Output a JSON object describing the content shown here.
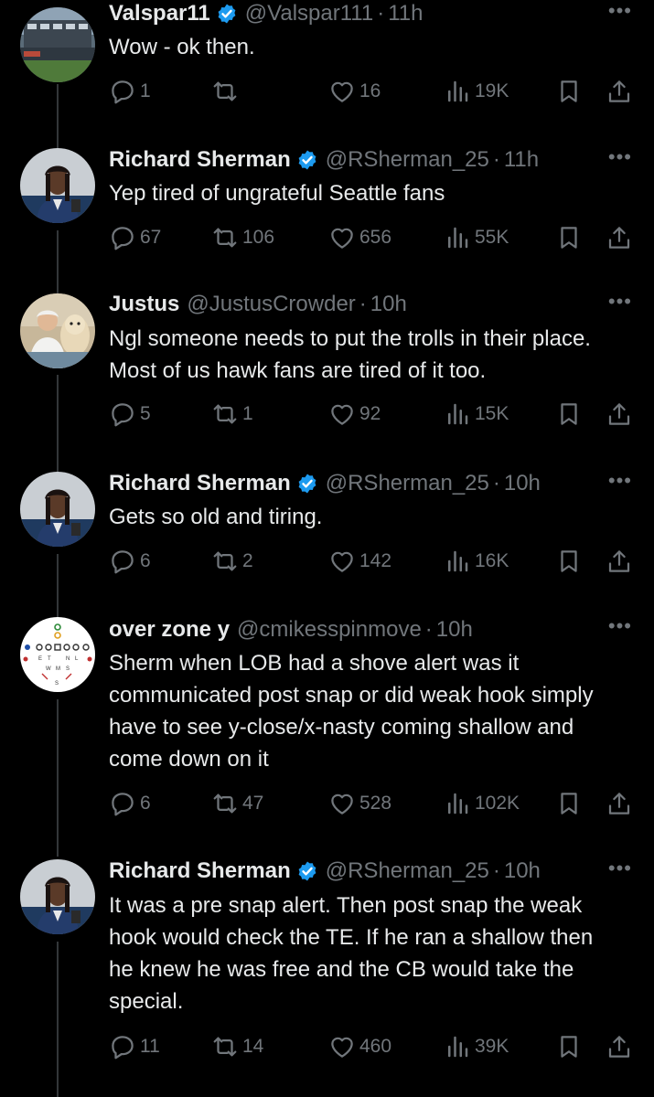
{
  "tweets": [
    {
      "name": "Valspar11",
      "verified": true,
      "handle": "@Valspar111",
      "time": "11h",
      "text": "Wow - ok then.",
      "replies": "1",
      "retweets": "",
      "likes": "16",
      "views": "19K"
    },
    {
      "name": "Richard Sherman",
      "verified": true,
      "handle": "@RSherman_25",
      "time": "11h",
      "text": "Yep tired of ungrateful Seattle fans",
      "replies": "67",
      "retweets": "106",
      "likes": "656",
      "views": "55K"
    },
    {
      "name": "Justus",
      "verified": false,
      "handle": "@JustusCrowder",
      "time": "10h",
      "text": "Ngl someone needs to put the trolls in their place. Most of us hawk fans are tired of it too.",
      "replies": "5",
      "retweets": "1",
      "likes": "92",
      "views": "15K"
    },
    {
      "name": "Richard Sherman",
      "verified": true,
      "handle": "@RSherman_25",
      "time": "10h",
      "text": "Gets so old and tiring.",
      "replies": "6",
      "retweets": "2",
      "likes": "142",
      "views": "16K"
    },
    {
      "name": "over zone y",
      "verified": false,
      "handle": "@cmikesspinmove",
      "time": "10h",
      "text": "Sherm when LOB had a shove alert was it communicated post snap or did weak hook simply have to see y-close/x-nasty coming shallow and come down on it",
      "replies": "6",
      "retweets": "47",
      "likes": "528",
      "views": "102K"
    },
    {
      "name": "Richard Sherman",
      "verified": true,
      "handle": "@RSherman_25",
      "time": "10h",
      "text": "It was a pre snap alert.  Then post snap the weak hook would check the TE.  If he ran a shallow then he knew he was free and the CB would take the special.",
      "replies": "11",
      "retweets": "14",
      "likes": "460",
      "views": "39K"
    }
  ],
  "ui": {
    "separator": "·",
    "more": "•••"
  },
  "colors": {
    "background": "#000000",
    "text": "#e7e9ea",
    "muted": "#71767b",
    "verified": "#1d9bf0",
    "thread_line": "#333639"
  }
}
